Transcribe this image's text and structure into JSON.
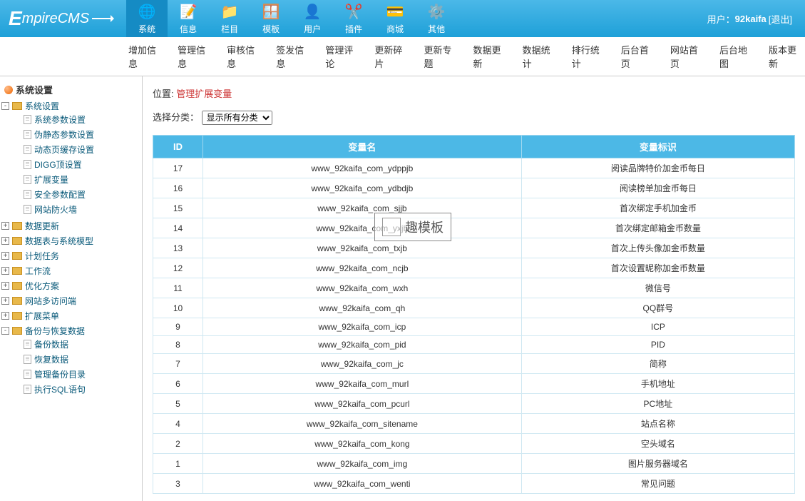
{
  "header": {
    "logo": "EmpireCMS",
    "nav": [
      {
        "label": "系统",
        "icon": "🌐",
        "active": true
      },
      {
        "label": "信息",
        "icon": "📝"
      },
      {
        "label": "栏目",
        "icon": "📁"
      },
      {
        "label": "模板",
        "icon": "🪟"
      },
      {
        "label": "用户",
        "icon": "👤"
      },
      {
        "label": "插件",
        "icon": "✂️"
      },
      {
        "label": "商城",
        "icon": "💳"
      },
      {
        "label": "其他",
        "icon": "⚙️"
      }
    ],
    "user_label": "用户：",
    "username": "92kaifa",
    "logout": "[退出]"
  },
  "subnav": [
    "增加信息",
    "管理信息",
    "审核信息",
    "签发信息",
    "管理评论",
    "更新碎片",
    "更新专题",
    "数据更新",
    "数据统计",
    "排行统计",
    "后台首页",
    "网站首页",
    "后台地图",
    "版本更新"
  ],
  "sidebar": {
    "title": "系统设置",
    "nodes": [
      {
        "label": "系统设置",
        "type": "folder",
        "open": true,
        "children": [
          {
            "label": "系统参数设置",
            "type": "doc"
          },
          {
            "label": "伪静态参数设置",
            "type": "doc"
          },
          {
            "label": "动态页缓存设置",
            "type": "doc"
          },
          {
            "label": "DIGG顶设置",
            "type": "doc"
          },
          {
            "label": "扩展变量",
            "type": "doc"
          },
          {
            "label": "安全参数配置",
            "type": "doc"
          },
          {
            "label": "网站防火墙",
            "type": "doc"
          }
        ]
      },
      {
        "label": "数据更新",
        "type": "folder"
      },
      {
        "label": "数据表与系统模型",
        "type": "folder"
      },
      {
        "label": "计划任务",
        "type": "folder"
      },
      {
        "label": "工作流",
        "type": "folder"
      },
      {
        "label": "优化方案",
        "type": "folder"
      },
      {
        "label": "网站多访问端",
        "type": "folder"
      },
      {
        "label": "扩展菜单",
        "type": "folder"
      },
      {
        "label": "备份与恢复数据",
        "type": "folder",
        "open": true,
        "children": [
          {
            "label": "备份数据",
            "type": "doc"
          },
          {
            "label": "恢复数据",
            "type": "doc"
          },
          {
            "label": "管理备份目录",
            "type": "doc"
          },
          {
            "label": "执行SQL语句",
            "type": "doc"
          }
        ]
      }
    ]
  },
  "content": {
    "crumb_label": "位置:",
    "crumb": "管理扩展变量",
    "filter_label": "选择分类：",
    "filter_option": "显示所有分类",
    "columns": [
      "ID",
      "变量名",
      "变量标识"
    ],
    "rows": [
      {
        "id": "17",
        "name": "www_92kaifa_com_ydppjb",
        "desc": "阅读品牌特价加金币每日"
      },
      {
        "id": "16",
        "name": "www_92kaifa_com_ydbdjb",
        "desc": "阅读榜单加金币每日"
      },
      {
        "id": "15",
        "name": "www_92kaifa_com_sjjb",
        "desc": "首次绑定手机加金币"
      },
      {
        "id": "14",
        "name": "www_92kaifa_com_yxjb",
        "desc": "首次绑定邮箱金币数量"
      },
      {
        "id": "13",
        "name": "www_92kaifa_com_txjb",
        "desc": "首次上传头像加金币数量"
      },
      {
        "id": "12",
        "name": "www_92kaifa_com_ncjb",
        "desc": "首次设置昵称加金币数量"
      },
      {
        "id": "11",
        "name": "www_92kaifa_com_wxh",
        "desc": "微信号"
      },
      {
        "id": "10",
        "name": "www_92kaifa_com_qh",
        "desc": "QQ群号"
      },
      {
        "id": "9",
        "name": "www_92kaifa_com_icp",
        "desc": "ICP"
      },
      {
        "id": "8",
        "name": "www_92kaifa_com_pid",
        "desc": "PID"
      },
      {
        "id": "7",
        "name": "www_92kaifa_com_jc",
        "desc": "简称"
      },
      {
        "id": "6",
        "name": "www_92kaifa_com_murl",
        "desc": "手机地址"
      },
      {
        "id": "5",
        "name": "www_92kaifa_com_pcurl",
        "desc": "PC地址"
      },
      {
        "id": "4",
        "name": "www_92kaifa_com_sitename",
        "desc": "站点名称"
      },
      {
        "id": "2",
        "name": "www_92kaifa_com_kong",
        "desc": "空头域名"
      },
      {
        "id": "1",
        "name": "www_92kaifa_com_img",
        "desc": "图片服务器域名"
      },
      {
        "id": "3",
        "name": "www_92kaifa_com_wenti",
        "desc": "常见问题"
      }
    ]
  },
  "watermark": "趣模板"
}
